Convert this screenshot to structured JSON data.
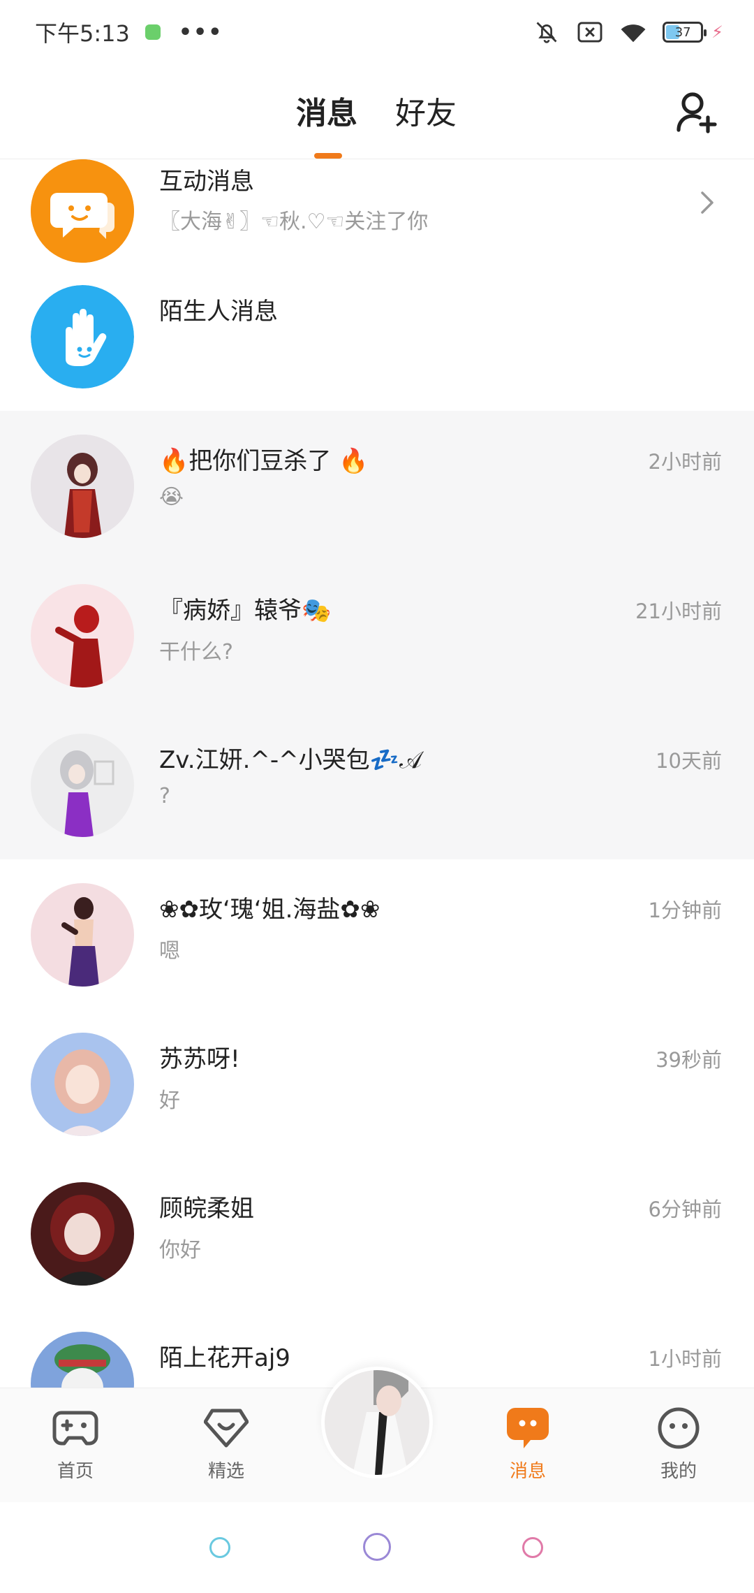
{
  "status_bar": {
    "time": "下午5:13",
    "dots": "•••",
    "battery": "37"
  },
  "header": {
    "tabs": [
      "消息",
      "好友"
    ]
  },
  "items": [
    {
      "title": "互动消息",
      "subtitle": "〖大海✌〗☜秋.♡☜关注了你",
      "time": ""
    },
    {
      "title": "陌生人消息",
      "subtitle": "",
      "time": ""
    },
    {
      "title": "🔥把你们豆杀了 🔥",
      "subtitle": "😭",
      "time": "2小时前"
    },
    {
      "title": "『病娇』辕爷🎭",
      "subtitle": "干什么?",
      "time": "21小时前"
    },
    {
      "title": "Zv.江妍.^-^小哭包💤𝒜",
      "subtitle": "?",
      "time": "10天前"
    },
    {
      "title": "❀✿玫‘瑰‘姐.海盐✿❀",
      "subtitle": "嗯",
      "time": "1分钟前"
    },
    {
      "title": "苏苏呀!",
      "subtitle": "好",
      "time": "39秒前"
    },
    {
      "title": "顾皖柔姐",
      "subtitle": "你好",
      "time": "6分钟前"
    },
    {
      "title": "陌上花开aj9",
      "subtitle": "",
      "time": "1小时前"
    }
  ],
  "bottom_nav": {
    "home": "首页",
    "featured": "精选",
    "messages": "消息",
    "mine": "我的"
  },
  "colors": {
    "accent": "#f07a1a",
    "stranger_blue": "#29aef0",
    "highlight_bg": "#f6f6f7"
  },
  "icons": [
    "mute-bell-icon",
    "sim-off-icon",
    "wifi-icon",
    "battery-icon",
    "add-friend-icon",
    "chevron-right-icon",
    "gamepad-icon",
    "heart-badge-icon",
    "chat-bubble-icon",
    "smiley-face-icon"
  ]
}
